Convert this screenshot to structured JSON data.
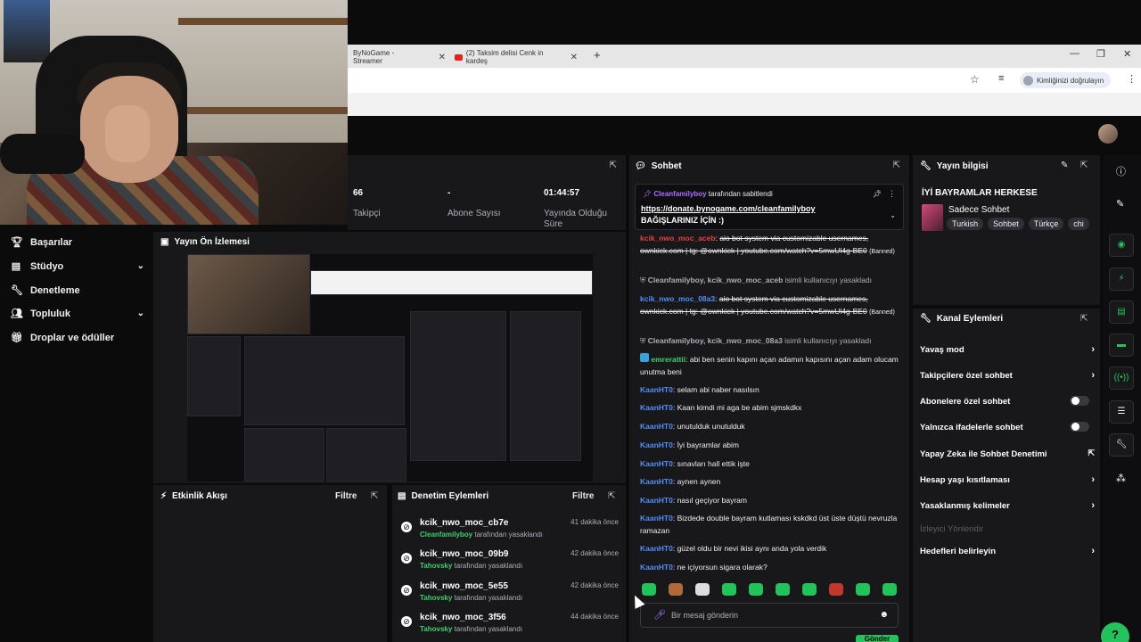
{
  "browser": {
    "tabs": [
      {
        "label": "ByNoGame - Streamer"
      },
      {
        "label": "(2) Taksim delisi Cenk in kardeş"
      }
    ],
    "verify_label": "Kimliğinizi doğrulayın"
  },
  "stats": {
    "followers": {
      "value": "66",
      "label": "Takipçi"
    },
    "subscribers": {
      "value": "-",
      "label": "Abone Sayısı"
    },
    "uptime": {
      "value": "01:44:57",
      "label": "Yayında Olduğu Süre"
    }
  },
  "nav": {
    "items": [
      {
        "label": "Başarılar",
        "icon": "trophy-icon"
      },
      {
        "label": "Stüdyo",
        "icon": "studio-icon"
      },
      {
        "label": "Denetleme",
        "icon": "wrench-icon"
      },
      {
        "label": "Topluluk",
        "icon": "community-icon"
      },
      {
        "label": "Droplar ve ödüller",
        "icon": "gift-icon"
      }
    ]
  },
  "preview": {
    "title": "Yayın Ön İzlemesi"
  },
  "activity": {
    "title": "Etkinlik Akışı",
    "filter": "Filtre"
  },
  "moderation": {
    "title": "Denetim Eylemleri",
    "filter": "Filtre",
    "rows": [
      {
        "user": "kcik_nwo_moc_cb7e",
        "by": "Cleanfamilyboy",
        "action": "tarafından yasaklandı",
        "time": "41 dakika önce"
      },
      {
        "user": "kcik_nwo_moc_09b9",
        "by": "Tahovsky",
        "action": "tarafından yasaklandı",
        "time": "42 dakika önce"
      },
      {
        "user": "kcik_nwo_moc_5e55",
        "by": "Tahovsky",
        "action": "tarafından yasaklandı",
        "time": "42 dakika önce"
      },
      {
        "user": "kcik_nwo_moc_3f56",
        "by": "Tahovsky",
        "action": "tarafından yasaklandı",
        "time": "44 dakika önce"
      }
    ]
  },
  "chat": {
    "title": "Sohbet",
    "pinned": {
      "by": "Cleanfamilyboy",
      "by_suffix": "tarafından sabitlendi",
      "link": "https://donate.bynogame.com/cleanfamilyboy",
      "message": "BAĞIŞLARINIZ İÇİN :)"
    },
    "spam1": {
      "user": "kcik_nwo_moc_aceb",
      "text": "aio bot system via customizable usernames, ownkick.com | tg: @ownkick | youtube.com/watch?v=5mwUl4g-BE0",
      "tag": "(Banned)"
    },
    "sys1": {
      "text": "Cleanfamilyboy, kcik_nwo_moc_aceb",
      "suffix": "isimli kullanıcıyı yasakladı"
    },
    "spam2": {
      "user": "kcik_nwo_moc_08a3",
      "text": "aio bot system via customizable usernames, ownkick.com | tg: @ownkick | youtube.com/watch?v=5mwUl4g-BE0",
      "tag": "(Banned)"
    },
    "sys2": {
      "text": "Cleanfamilyboy, kcik_nwo_moc_08a3",
      "suffix": "isimli kullanıcıyı yasakladı"
    },
    "msg_emre": {
      "user": "emrerattii",
      "text": ": abi ben senin kapını açan adamın kapısını açan adam olucam unutma beni"
    },
    "messages": [
      {
        "user": "KaanHT0",
        "text": ": selam abi naber nasılsın"
      },
      {
        "user": "KaanHT0",
        "text": ": Kaan kimdi mi aga be abim sjmskdkx"
      },
      {
        "user": "KaanHT0",
        "text": ": unutulduk unutulduk"
      },
      {
        "user": "KaanHT0",
        "text": ": İyi bayramlar abim"
      },
      {
        "user": "KaanHT0",
        "text": ": sınavları hall ettik işte"
      },
      {
        "user": "KaanHT0",
        "text": ": aynen aynen"
      },
      {
        "user": "KaanHT0",
        "text": ": nasıl geçiyor bayram"
      },
      {
        "user": "KaanHT0",
        "text": ": Bizdede double bayram kutlaması kskdkd üst üste düştü nevruzla ramazan"
      },
      {
        "user": "KaanHT0",
        "text": ": güzel oldu bir nevi ikisi aynı anda yola verdik"
      },
      {
        "user": "KaanHT0",
        "text": ": ne içiyorsun sigara olarak?"
      }
    ],
    "input_placeholder": "Bir mesaj gönderin",
    "send_label": "Gönder"
  },
  "stream_info": {
    "title": "Yayın bilgisi",
    "stream_title": "İYİ BAYRAMLAR HERKESE",
    "category": "Sadece Sohbet",
    "tags": [
      "Turkish",
      "Sohbet",
      "Türkçe",
      "chi"
    ]
  },
  "channel_actions": {
    "title": "Kanal Eylemleri",
    "items": [
      {
        "label": "Yavaş mod",
        "control": "chevron"
      },
      {
        "label": "Takipçilere özel sohbet",
        "control": "chevron"
      },
      {
        "label": "Abonelere özel sohbet",
        "control": "toggle"
      },
      {
        "label": "Yalnızca ifadelerle sohbet",
        "control": "toggle"
      },
      {
        "label": "Yapay Zeka ile Sohbet Denetimi",
        "control": "external"
      },
      {
        "label": "Hesap yaşı kısıtlaması",
        "control": "chevron"
      },
      {
        "label": "Yasaklanmış kelimeler",
        "control": "chevron"
      },
      {
        "label": "İzleyici Yönlendir",
        "control": "none"
      },
      {
        "label": "Hedefleri belirleyin",
        "control": "chevron"
      }
    ]
  },
  "colors": {
    "accent": "#22c35a",
    "panel": "#18181b",
    "username_blue": "#4f8ff7",
    "ban_red": "#e24242"
  }
}
